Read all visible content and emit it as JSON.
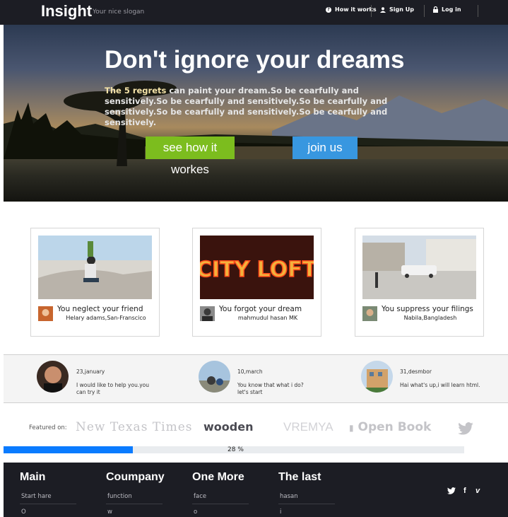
{
  "nav": {
    "brand": "Insight",
    "slogan": "Your nice slogan",
    "links": [
      {
        "label": "How it works",
        "icon": "question-icon"
      },
      {
        "label": "Sign Up",
        "icon": "user-icon"
      },
      {
        "label": "Log in",
        "icon": "lock-icon"
      }
    ]
  },
  "hero": {
    "title": "Don't ignore your dreams",
    "lead_bold": "The 5 regrets",
    "lead_rest": " can paint your dream.So be cearfully and sensitively.So be cearfully and sensitively.So be cearfully and sensitively.So be cearfully and sensitively.So be cearfully and sensitively.",
    "primary_button": "see how it workes",
    "secondary_button": "join us"
  },
  "cards": [
    {
      "title": "You neglect your friend",
      "author": "Helary adams,San-Franscico"
    },
    {
      "title": "You forgot your dream",
      "author": "mahmudul hasan MK",
      "image_text": "CITY LOFT"
    },
    {
      "title": "You suppress your filings",
      "author": "Nabila,Bangladesh"
    }
  ],
  "testimonials": [
    {
      "date": "23,january",
      "text": "I would like to help you.you can try it"
    },
    {
      "date": "10,march",
      "text": "You know that what i do? let's start"
    },
    {
      "date": "31,desmbor",
      "text": "Hai what's up,i will learn html."
    }
  ],
  "featured": {
    "label": "Featured on:",
    "logos": [
      "New Texas Times",
      "wooden",
      "VREMYA",
      "Open Book",
      "twitter-icon"
    ]
  },
  "progress": {
    "value": 28,
    "label": "28 %"
  },
  "footer": {
    "columns": [
      {
        "title": "Main",
        "items": [
          "Start hare",
          "O"
        ]
      },
      {
        "title": "Coumpany",
        "items": [
          "function",
          "w"
        ]
      },
      {
        "title": "One More",
        "items": [
          "face",
          "o"
        ]
      },
      {
        "title": "The last",
        "items": [
          "hasan",
          "i"
        ]
      }
    ],
    "social": [
      "twitter-icon",
      "facebook-icon",
      "vimeo-icon"
    ]
  },
  "colors": {
    "nav_bg": "#1c1d24",
    "green": "#7cbd1e",
    "blue": "#3897e0",
    "progress": "#0a7bff"
  }
}
